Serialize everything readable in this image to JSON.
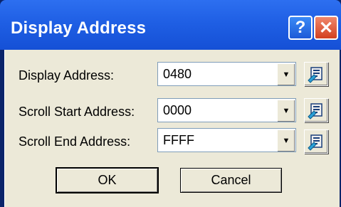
{
  "window": {
    "title": "Display Address",
    "help_glyph": "?",
    "close_glyph": "✕"
  },
  "fields": [
    {
      "label": "Display Address:",
      "value": "0480"
    },
    {
      "label": "Scroll Start Address:",
      "value": "0000"
    },
    {
      "label": "Scroll End Address:",
      "value": "FFFF"
    }
  ],
  "buttons": {
    "ok": "OK",
    "cancel": "Cancel"
  },
  "icons": {
    "dropdown": "▼"
  }
}
